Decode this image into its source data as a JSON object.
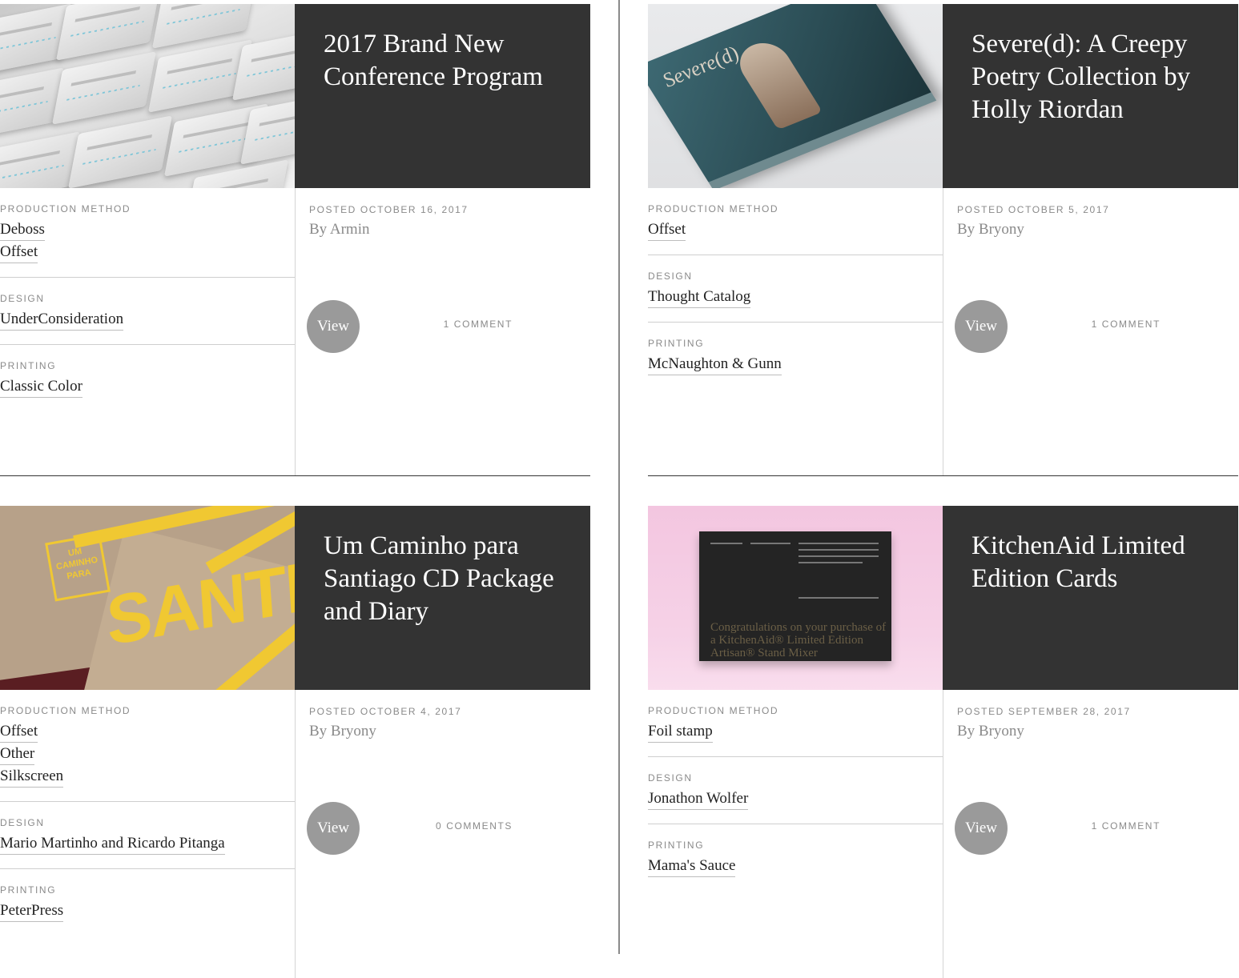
{
  "posts": [
    {
      "title": "2017 Brand New Conference Program",
      "production_method_label": "PRODUCTION METHOD",
      "production_methods": [
        "Deboss",
        "Offset"
      ],
      "design_label": "DESIGN",
      "design": "UnderConsideration",
      "printing_label": "PRINTING",
      "printing": "Classic Color",
      "posted": "POSTED OCTOBER 16, 2017",
      "author": "By Armin",
      "view_label": "View",
      "comments": "1 COMMENT"
    },
    {
      "title": "Severe(d): A Creepy Poetry Collection by Holly Riordan",
      "production_method_label": "PRODUCTION METHOD",
      "production_methods": [
        "Offset"
      ],
      "design_label": "DESIGN",
      "design": "Thought Catalog",
      "printing_label": "PRINTING",
      "printing": "McNaughton & Gunn",
      "posted": "POSTED OCTOBER 5, 2017",
      "author": "By Bryony",
      "view_label": "View",
      "comments": "1 COMMENT",
      "thumb_text": "Severe(d)"
    },
    {
      "title": "Um Caminho para Santiago CD Package and Diary",
      "production_method_label": "PRODUCTION METHOD",
      "production_methods": [
        "Offset",
        "Other",
        "Silkscreen"
      ],
      "design_label": "DESIGN",
      "design": "Mario Martinho and Ricardo Pitanga",
      "printing_label": "PRINTING",
      "printing": "PeterPress",
      "posted": "POSTED OCTOBER 4, 2017",
      "author": "By Bryony",
      "view_label": "View",
      "comments": "0 COMMENTS",
      "thumb_text": "SANTIAGO",
      "thumb_box_text": "UM CAMINHO PARA"
    },
    {
      "title": "KitchenAid Limited Edition Cards",
      "production_method_label": "PRODUCTION METHOD",
      "production_methods": [
        "Foil stamp"
      ],
      "design_label": "DESIGN",
      "design": "Jonathon Wolfer",
      "printing_label": "PRINTING",
      "printing": "Mama's Sauce",
      "posted": "POSTED SEPTEMBER 28, 2017",
      "author": "By Bryony",
      "view_label": "View",
      "comments": "1 COMMENT",
      "thumb_text": "Congratulations on your purchase of a KitchenAid® Limited Edition Artisan® Stand Mixer"
    }
  ],
  "colors": {
    "title_block_bg": "#333333",
    "view_button_bg": "#9a9a9a",
    "label_gray": "#8a8a8a"
  }
}
